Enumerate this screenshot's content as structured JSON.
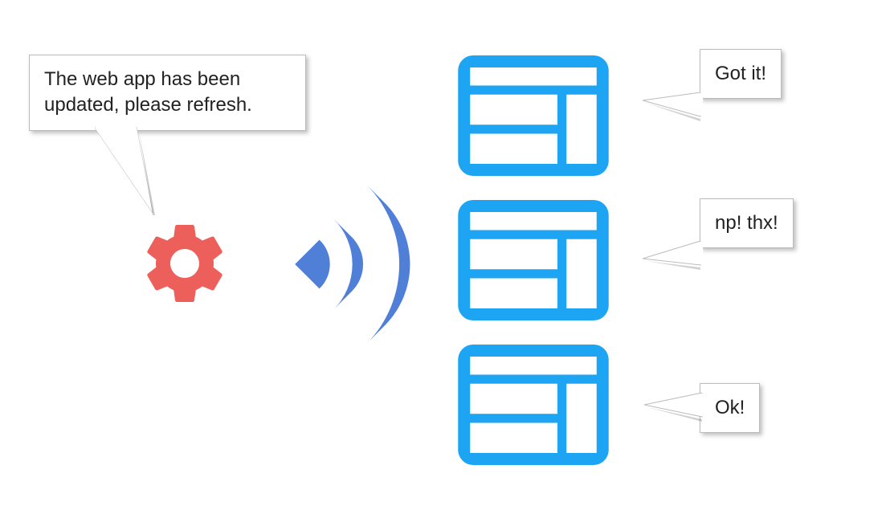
{
  "colors": {
    "gear": "#ED5F5A",
    "broadcast": "#507FD8",
    "card": "#1DA5F3",
    "bubble_border": "#bbb"
  },
  "service_worker": {
    "message": "The web app has been updated, please refresh."
  },
  "clients": [
    {
      "response": "Got it!"
    },
    {
      "response": "np! thx!"
    },
    {
      "response": "Ok!"
    }
  ],
  "icons": {
    "gear": "gear-icon",
    "broadcast": "broadcast-icon",
    "app_window": "app-window-icon"
  }
}
